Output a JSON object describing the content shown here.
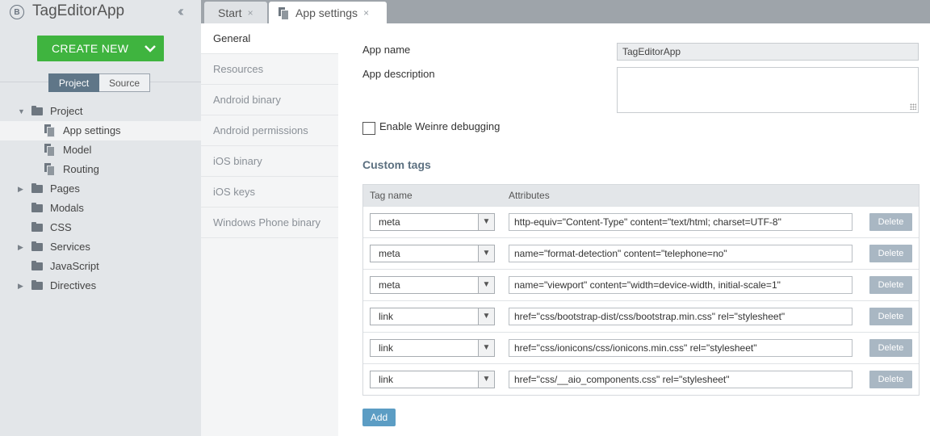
{
  "app": {
    "logo_letter": "B",
    "title": "TagEditorApp",
    "collapse_glyph": "«"
  },
  "create_new": {
    "label": "CREATE NEW"
  },
  "view_toggle": {
    "project": "Project",
    "source": "Source",
    "active": "Project"
  },
  "tree": {
    "project": "Project",
    "app_settings": "App settings",
    "model": "Model",
    "routing": "Routing",
    "pages": "Pages",
    "modals": "Modals",
    "css": "CSS",
    "services": "Services",
    "javascript": "JavaScript",
    "directives": "Directives"
  },
  "tabs": {
    "start": "Start",
    "app_settings": "App settings",
    "close_glyph": "×"
  },
  "settings_nav": {
    "general": "General",
    "resources": "Resources",
    "android_binary": "Android binary",
    "android_permissions": "Android permissions",
    "ios_binary": "iOS binary",
    "ios_keys": "iOS keys",
    "windows_phone_binary": "Windows Phone binary"
  },
  "form": {
    "app_name_label": "App name",
    "app_name_value": "TagEditorApp",
    "app_description_label": "App description",
    "app_description_value": "",
    "weinre_label": "Enable Weinre debugging",
    "weinre_checked": false
  },
  "custom_tags": {
    "title": "Custom tags",
    "col_tag": "Tag name",
    "col_attributes": "Attributes",
    "delete_label": "Delete",
    "add_label": "Add",
    "rows": [
      {
        "tag": "meta",
        "attributes": "http-equiv=\"Content-Type\" content=\"text/html; charset=UTF-8\""
      },
      {
        "tag": "meta",
        "attributes": "name=\"format-detection\" content=\"telephone=no\""
      },
      {
        "tag": "meta",
        "attributes": "name=\"viewport\" content=\"width=device-width, initial-scale=1\""
      },
      {
        "tag": "link",
        "attributes": "href=\"css/bootstrap-dist/css/bootstrap.min.css\" rel=\"stylesheet\""
      },
      {
        "tag": "link",
        "attributes": "href=\"css/ionicons/css/ionicons.min.css\" rel=\"stylesheet\""
      },
      {
        "tag": "link",
        "attributes": "href=\"css/__aio_components.css\" rel=\"stylesheet\""
      }
    ]
  },
  "colors": {
    "create_new_green": "#3fb43f",
    "toggle_active": "#5f7688",
    "delete_button": "#a9b7c3",
    "add_button": "#5c9dc4",
    "section_title": "#5c7080"
  }
}
